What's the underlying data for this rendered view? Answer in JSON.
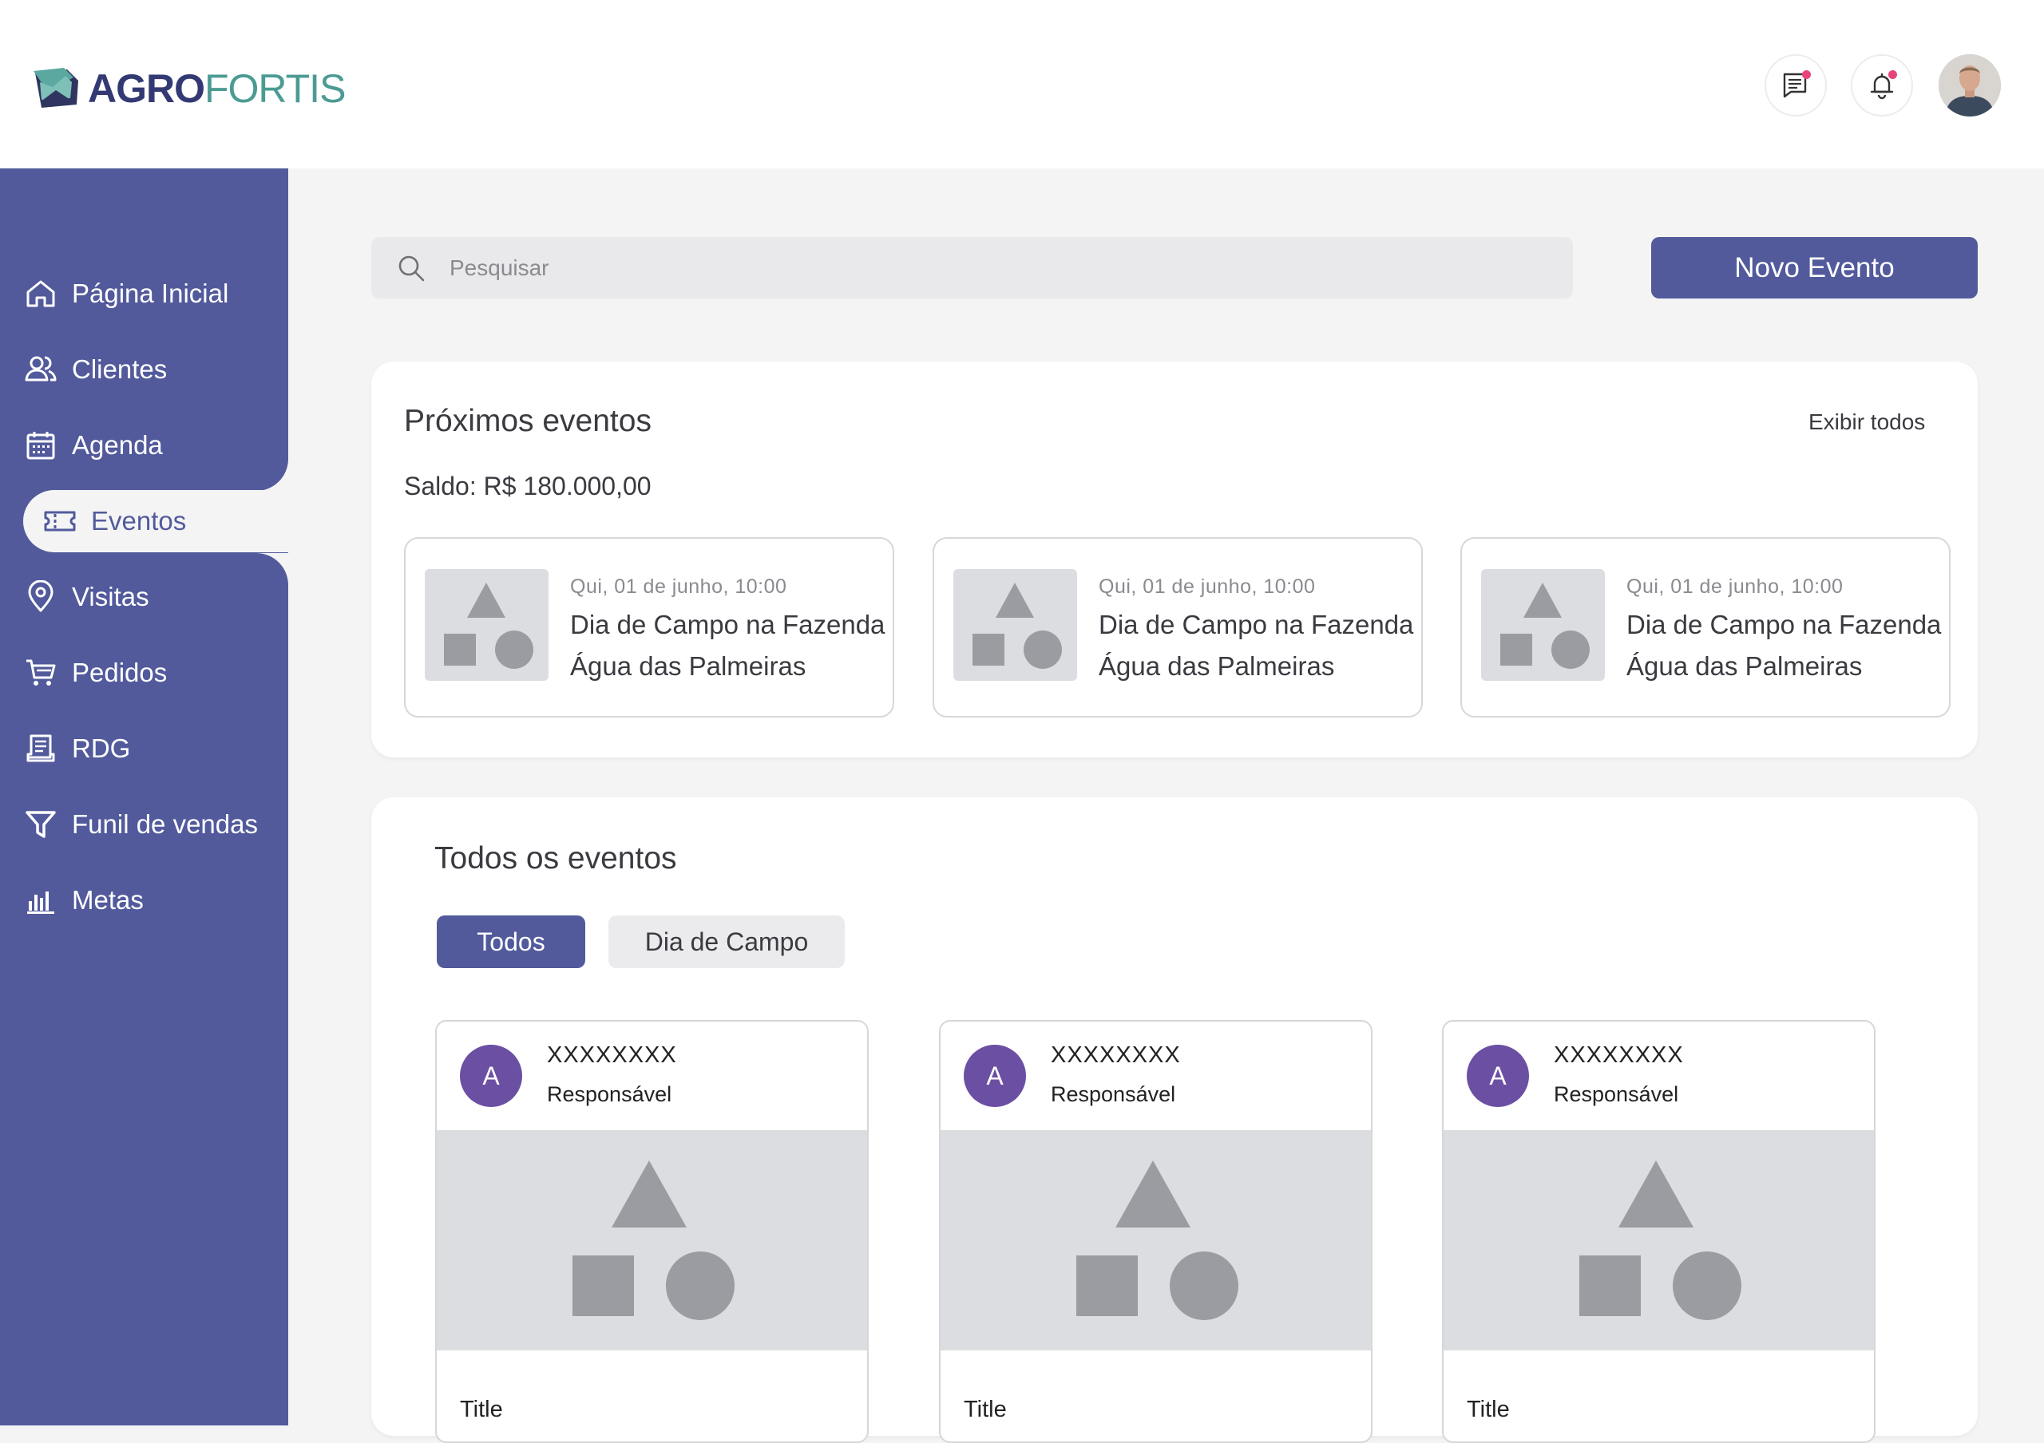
{
  "brand": {
    "part1": "AGRO",
    "part2": "FORTIS"
  },
  "colors": {
    "primary": "#525a9c",
    "teal": "#4b9b93",
    "navy": "#333a73",
    "badge": "#e8447a",
    "avatar_purple": "#6b4fa3",
    "background": "#f4f4f5"
  },
  "header": {
    "icons": [
      "chat-icon",
      "bell-icon"
    ],
    "avatar": "user-avatar"
  },
  "sidebar": {
    "items": [
      {
        "label": "Página Inicial",
        "icon": "home-icon"
      },
      {
        "label": "Clientes",
        "icon": "users-icon"
      },
      {
        "label": "Agenda",
        "icon": "calendar-icon"
      },
      {
        "label": "Eventos",
        "icon": "ticket-icon",
        "active": true
      },
      {
        "label": "Visitas",
        "icon": "location-pin-icon"
      },
      {
        "label": "Pedidos",
        "icon": "cart-icon"
      },
      {
        "label": "RDG",
        "icon": "receipt-icon"
      },
      {
        "label": "Funil de vendas",
        "icon": "funnel-icon"
      },
      {
        "label": "Metas",
        "icon": "bar-chart-icon"
      }
    ]
  },
  "search": {
    "placeholder": "Pesquisar"
  },
  "actions": {
    "new_event": "Novo Evento"
  },
  "upcoming": {
    "title": "Próximos eventos",
    "view_all": "Exibir todos",
    "balance": "Saldo: R$ 180.000,00",
    "events": [
      {
        "date": "Qui, 01 de junho, 10:00",
        "name": "Dia de Campo na Fazenda Água das Palmeiras"
      },
      {
        "date": "Qui, 01 de junho, 10:00",
        "name": "Dia de Campo na Fazenda Água das Palmeiras"
      },
      {
        "date": "Qui, 01 de junho, 10:00",
        "name": "Dia de Campo na Fazenda Água das Palmeiras"
      }
    ]
  },
  "all_events": {
    "title": "Todos os eventos",
    "tabs": [
      {
        "label": "Todos",
        "active": true
      },
      {
        "label": "Dia de Campo",
        "active": false
      }
    ],
    "cards": [
      {
        "initial": "A",
        "name": "XXXXXXXX",
        "role": "Responsável",
        "title": "Title"
      },
      {
        "initial": "A",
        "name": "XXXXXXXX",
        "role": "Responsável",
        "title": "Title"
      },
      {
        "initial": "A",
        "name": "XXXXXXXX",
        "role": "Responsável",
        "title": "Title"
      }
    ]
  }
}
